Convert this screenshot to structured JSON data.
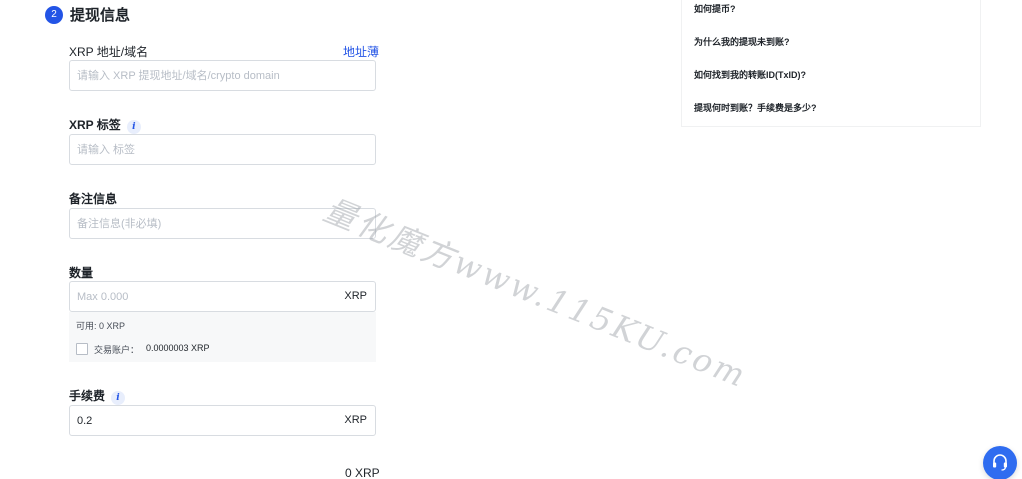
{
  "section": {
    "step": "2",
    "title": "提现信息"
  },
  "address": {
    "label": "XRP 地址/域名",
    "link": "地址薄",
    "placeholder": "请输入 XRP 提现地址/域名/crypto domain"
  },
  "tag": {
    "label": "XRP 标签",
    "info_icon": "i",
    "placeholder": "请输入 标签"
  },
  "memo": {
    "label": "备注信息",
    "placeholder": "备注信息(非必填)"
  },
  "amount": {
    "label": "数量",
    "placeholder": "Max 0.000",
    "unit": "XRP",
    "available": "可用:  0 XRP",
    "trade_account_label": "交易账户：",
    "trade_account_value": "0.0000003 XRP",
    "trade_account_checked": false
  },
  "fee": {
    "label": "手续费",
    "info_icon": "i",
    "value": "0.2",
    "unit": "XRP"
  },
  "received": {
    "value": "0 XRP"
  },
  "faq": {
    "items": [
      "如何提币?",
      "为什么我的提现未到账?",
      "如何找到我的转账ID(TxID)?",
      "提现何时到账？手续费是多少?"
    ]
  },
  "watermark": "量化魔方www.115KU.com",
  "icons": {
    "support": "headset-icon",
    "info": "info-icon"
  },
  "colors": {
    "accent": "#2354e6",
    "support_button": "#2f6cf0"
  }
}
